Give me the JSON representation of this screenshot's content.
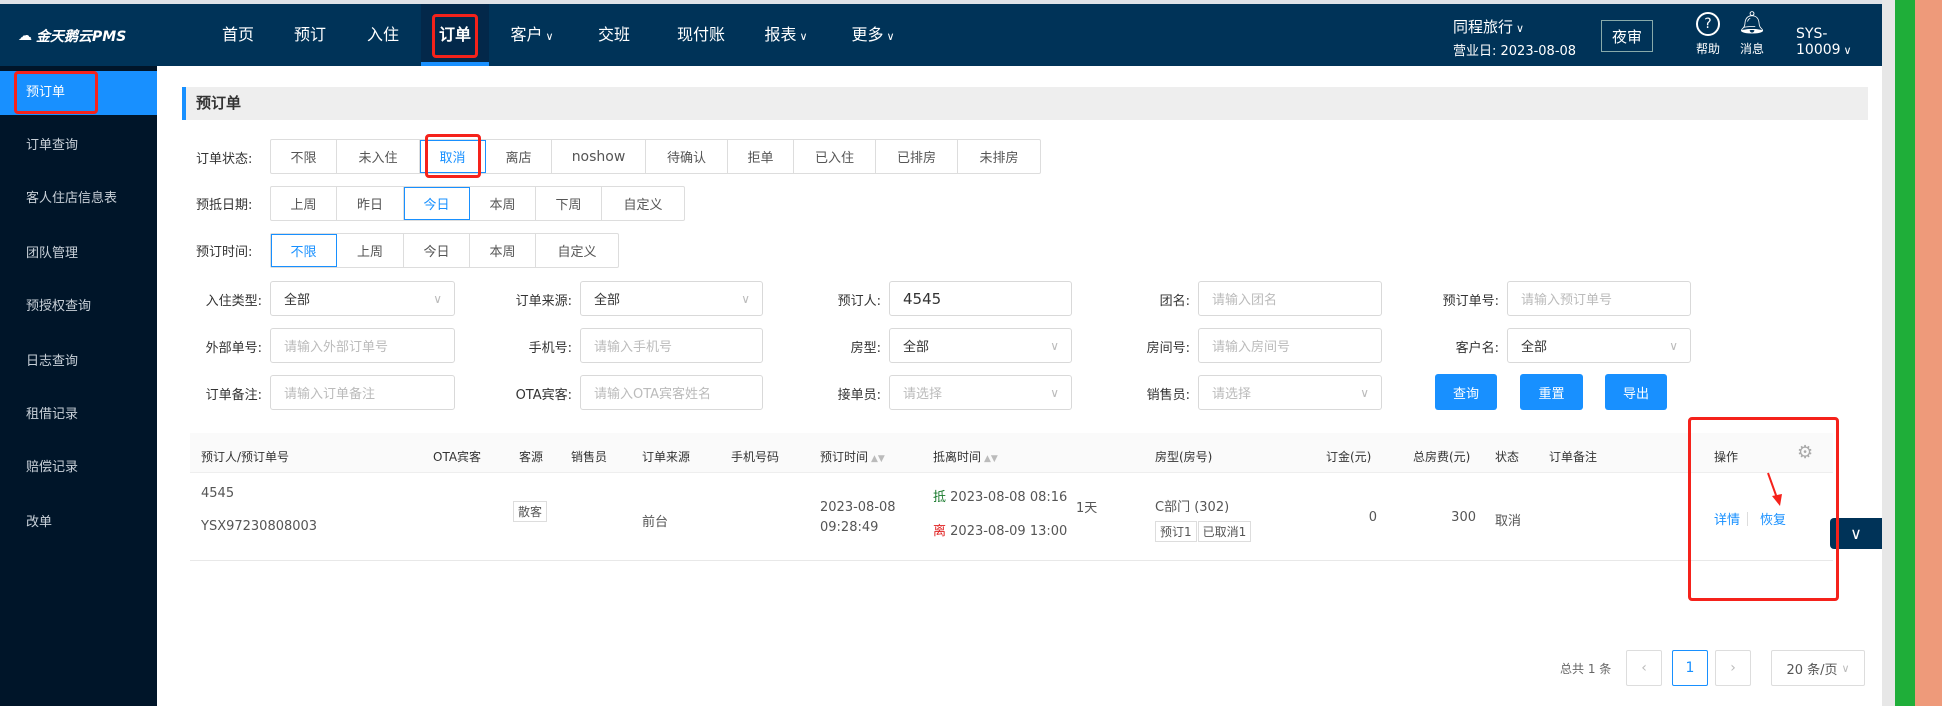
{
  "header": {
    "logo": "金天鹅云PMS",
    "nav": [
      {
        "label": "首页"
      },
      {
        "label": "预订"
      },
      {
        "label": "入住"
      },
      {
        "label": "订单",
        "active": true
      },
      {
        "label": "客户",
        "dropdown": true
      },
      {
        "label": "交班"
      },
      {
        "label": "现付账"
      },
      {
        "label": "报表",
        "dropdown": true
      },
      {
        "label": "更多",
        "dropdown": true
      }
    ],
    "hotel": "同程旅行",
    "business_day": "营业日: 2023-08-08",
    "night_audit": "夜审",
    "help": "帮助",
    "messages": "消息",
    "user": "SYS-10009"
  },
  "sidebar": {
    "items": [
      {
        "label": "预订单",
        "active": true
      },
      {
        "label": "订单查询"
      },
      {
        "label": "客人住店信息表"
      },
      {
        "label": "团队管理"
      },
      {
        "label": "预授权查询"
      },
      {
        "label": "日志查询"
      },
      {
        "label": "租借记录"
      },
      {
        "label": "赔偿记录"
      },
      {
        "label": "改单"
      }
    ]
  },
  "page": {
    "title": "预订单"
  },
  "filters": {
    "status": {
      "label": "订单状态:",
      "options": [
        "不限",
        "未入住",
        "取消",
        "离店",
        "noshow",
        "待确认",
        "拒单",
        "已入住",
        "已排房",
        "未排房"
      ],
      "selected": "取消"
    },
    "arrival": {
      "label": "预抵日期:",
      "options": [
        "上周",
        "昨日",
        "今日",
        "本周",
        "下周",
        "自定义"
      ],
      "selected": "今日"
    },
    "booking_time": {
      "label": "预订时间:",
      "options": [
        "不限",
        "上周",
        "今日",
        "本周",
        "自定义"
      ],
      "selected": "不限"
    },
    "fields": [
      {
        "label": "入住类型:",
        "value": "全部",
        "select": true
      },
      {
        "label": "订单来源:",
        "value": "全部",
        "select": true
      },
      {
        "label": "预订人:",
        "value": "4545"
      },
      {
        "label": "团名:",
        "placeholder": "请输入团名"
      },
      {
        "label": "预订单号:",
        "placeholder": "请输入预订单号"
      },
      {
        "label": "外部单号:",
        "placeholder": "请输入外部订单号"
      },
      {
        "label": "手机号:",
        "placeholder": "请输入手机号"
      },
      {
        "label": "房型:",
        "value": "全部",
        "select": true
      },
      {
        "label": "房间号:",
        "placeholder": "请输入房间号"
      },
      {
        "label": "客户名:",
        "value": "全部",
        "select": true
      },
      {
        "label": "订单备注:",
        "placeholder": "请输入订单备注"
      },
      {
        "label": "OTA宾客:",
        "placeholder": "请输入OTA宾客姓名"
      },
      {
        "label": "接单员:",
        "placeholder": "请选择",
        "select": true
      },
      {
        "label": "销售员:",
        "placeholder": "请选择",
        "select": true
      }
    ],
    "buttons": {
      "search": "查询",
      "reset": "重置",
      "export": "导出"
    }
  },
  "table": {
    "columns": [
      "预订人/预订单号",
      "OTA宾客",
      "客源",
      "销售员",
      "订单来源",
      "手机号码",
      "预订时间",
      "抵离时间",
      "房型(房号)",
      "订金(元)",
      "总房费(元)",
      "状态",
      "订单备注",
      "操作"
    ],
    "rows": [
      {
        "booker": "4545",
        "order_no": "YSX97230808003",
        "source_type": "散客",
        "channel": "前台",
        "booking_date": "2023-08-08",
        "booking_clock": "09:28:49",
        "arrive_tag": "抵",
        "arrive": "2023-08-08 08:16",
        "depart_tag": "离",
        "depart": "2023-08-09 13:00",
        "nights": "1天",
        "room": "C部门 (302)",
        "room_tags": [
          "预订1",
          "已取消1"
        ],
        "deposit": "0",
        "total": "300",
        "status": "取消",
        "actions": [
          "详情",
          "恢复"
        ]
      }
    ]
  },
  "pagination": {
    "total": "总共 1 条",
    "current": "1",
    "page_size": "20 条/页"
  },
  "colors": {
    "header": "#003358",
    "sidebar": "#001529",
    "accent": "#1890ff",
    "annotation": "#f5221b"
  }
}
